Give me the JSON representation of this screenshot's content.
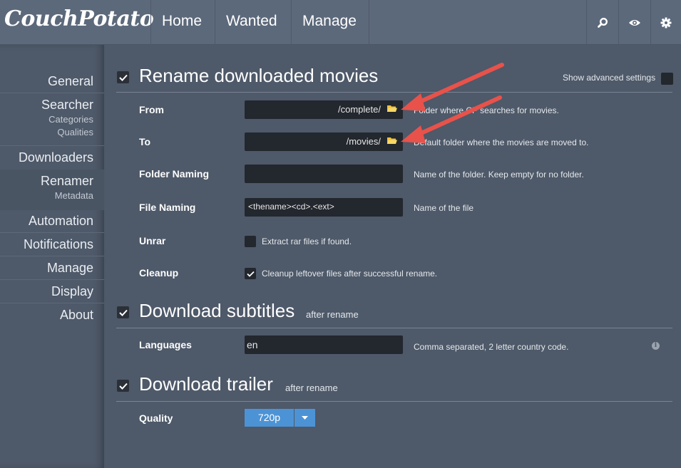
{
  "app": {
    "logo": "CouchPotato"
  },
  "nav": {
    "home": "Home",
    "wanted": "Wanted",
    "manage": "Manage"
  },
  "header_icons": [
    "search-icon",
    "eye-icon",
    "gear-icon"
  ],
  "sidebar": {
    "general": "General",
    "searcher": "Searcher",
    "searcher_sub1": "Categories",
    "searcher_sub2": "Qualities",
    "downloaders": "Downloaders",
    "renamer": "Renamer",
    "renamer_sub": "Metadata",
    "automation": "Automation",
    "notifications": "Notifications",
    "manage": "Manage",
    "display": "Display",
    "about": "About"
  },
  "advanced": {
    "label": "Show advanced settings",
    "checked": false
  },
  "rename": {
    "title": "Rename downloaded movies",
    "enabled": true,
    "from": {
      "label": "From",
      "value": "/complete/",
      "hint": "Folder where CP searches for movies."
    },
    "to": {
      "label": "To",
      "value": "/movies/",
      "hint": "Default folder where the movies are moved to."
    },
    "folder_naming": {
      "label": "Folder Naming",
      "value": "",
      "hint": "Name of the folder. Keep empty for no folder."
    },
    "file_naming": {
      "label": "File Naming",
      "value": "<thename><cd>.<ext>",
      "hint": "Name of the file"
    },
    "unrar": {
      "label": "Unrar",
      "checkbox_label": "Extract rar files if found.",
      "checked": false
    },
    "cleanup": {
      "label": "Cleanup",
      "checkbox_label": "Cleanup leftover files after successful rename.",
      "checked": true
    }
  },
  "subtitles": {
    "title": "Download subtitles",
    "after": "after rename",
    "enabled": true,
    "languages": {
      "label": "Languages",
      "value": "en",
      "hint": "Comma separated, 2 letter country code."
    }
  },
  "trailer": {
    "title": "Download trailer",
    "after": "after rename",
    "enabled": true,
    "quality": {
      "label": "Quality",
      "value": "720p"
    }
  },
  "colors": {
    "accent": "#4c93d6",
    "arrow": "#e8524a",
    "background": "#4e5969",
    "header": "#5c697b"
  }
}
